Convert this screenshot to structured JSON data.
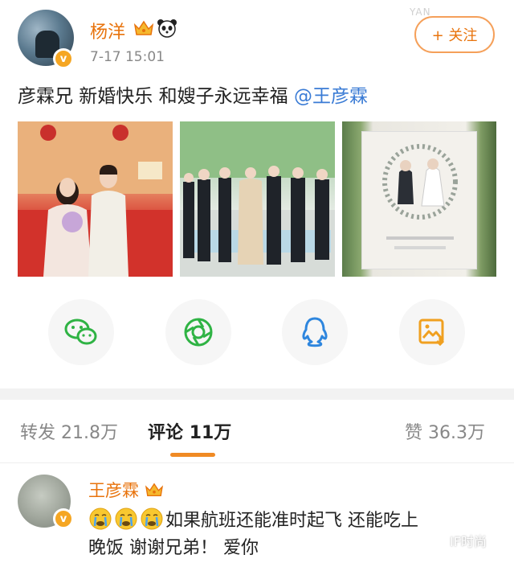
{
  "post": {
    "username": "杨洋",
    "timestamp": "7-17 15:01",
    "follow_label": "+ 关注",
    "text_main": "彦霖兄 新婚快乐 和嫂子永远幸福 ",
    "mention": "@王彦霖",
    "watermark_top": "YAN"
  },
  "share": {
    "icons": [
      "wechat-icon",
      "moments-icon",
      "qq-icon",
      "save-image-icon"
    ],
    "colors": {
      "wechat": "#2fb344",
      "moments": "#2fb344",
      "qq": "#2e86de",
      "save": "#f0a020"
    }
  },
  "tabs": {
    "repost_label": "转发",
    "repost_count": "21.8万",
    "comment_label": "评论",
    "comment_count": "11万",
    "like_label": "赞",
    "like_count": "36.3万"
  },
  "comment": {
    "username": "王彦霖",
    "text_line1": "如果航班还能准时起飞 还能吃上",
    "text_line2": "晚饭 谢谢兄弟！ 爱你"
  },
  "watermark_bottom": "IF时尚",
  "colors": {
    "accent_orange": "#e8730c",
    "mention_blue": "#3a7bd5",
    "tab_underline": "#f08a24"
  }
}
